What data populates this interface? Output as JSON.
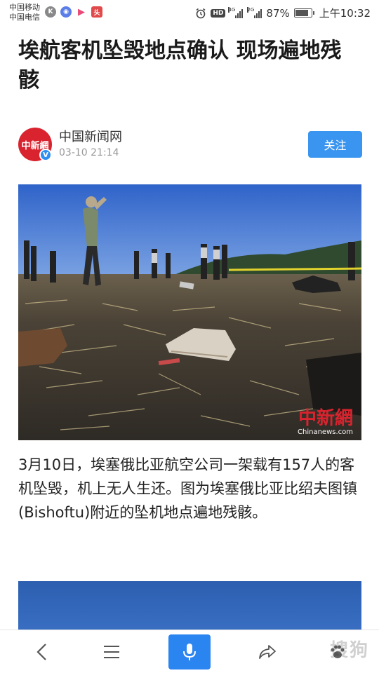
{
  "status_bar": {
    "carrier_1": "中国移动",
    "carrier_2": "中国电信",
    "hd": "HD",
    "net_1": "4G",
    "net_2": "2G",
    "battery_level": 0.87,
    "battery_percent": "87%",
    "time": "上午10:32"
  },
  "article": {
    "title": "埃航客机坠毁地点确认 现场遍地残骸",
    "source": {
      "avatar_text": "中新網",
      "name": "中国新闻网",
      "time": "03-10 21:14",
      "follow_label": "关注"
    },
    "photo": {
      "watermark_logo": "中新網",
      "watermark_url": "Chinanews.com"
    },
    "caption": "3月10日，埃塞俄比亚航空公司一架载有157人的客机坠毁，机上无人生还。图为埃塞俄比亚比绍夫图镇(Bishoftu)附近的坠机地点遍地残骸。"
  },
  "bottom_nav": {
    "watermark": "搜狗"
  },
  "colors": {
    "accent": "#3a95f0",
    "mic": "#2b85f0",
    "brand_red": "#d9232e"
  }
}
